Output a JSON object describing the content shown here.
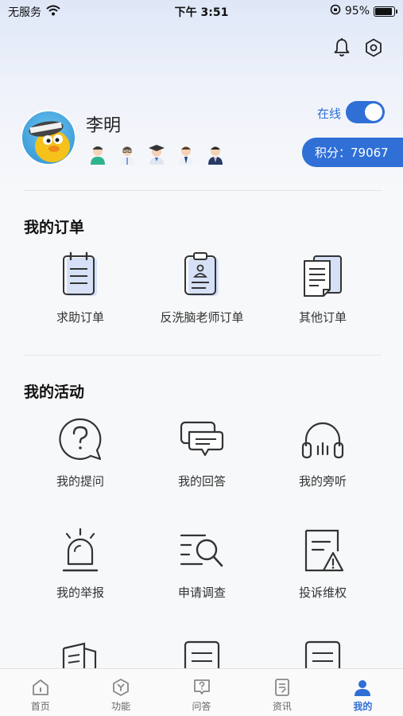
{
  "status_bar": {
    "carrier": "无服务",
    "time": "下午 3:51",
    "battery": "95%"
  },
  "header": {
    "icons": [
      "bell-icon",
      "settings-icon"
    ]
  },
  "profile": {
    "name": "李明",
    "online_label": "在线",
    "online": true,
    "points_text": "积分：79067",
    "badge_icons": [
      "nurse-badge-icon",
      "doctor-badge-icon",
      "graduate-badge-icon",
      "officer-badge-icon",
      "businessman-badge-icon"
    ]
  },
  "orders": {
    "title": "我的订单",
    "items": [
      {
        "label": "求助订单",
        "icon": "clipboard-icon"
      },
      {
        "label": "反洗脑老师订单",
        "icon": "teacher-clipboard-icon"
      },
      {
        "label": "其他订单",
        "icon": "documents-icon"
      }
    ]
  },
  "activities": {
    "title": "我的活动",
    "items": [
      {
        "label": "我的提问",
        "icon": "question-bubble-icon"
      },
      {
        "label": "我的回答",
        "icon": "answer-bubbles-icon"
      },
      {
        "label": "我的旁听",
        "icon": "headphones-icon"
      },
      {
        "label": "我的举报",
        "icon": "alarm-light-icon"
      },
      {
        "label": "申请调查",
        "icon": "search-list-icon"
      },
      {
        "label": "投诉维权",
        "icon": "complaint-document-icon"
      }
    ]
  },
  "tabs": [
    {
      "label": "首页",
      "icon": "home-icon",
      "active": false
    },
    {
      "label": "功能",
      "icon": "function-hexagon-icon",
      "active": false
    },
    {
      "label": "问答",
      "icon": "qa-icon",
      "active": false
    },
    {
      "label": "资讯",
      "icon": "news-icon",
      "active": false
    },
    {
      "label": "我的",
      "icon": "user-icon",
      "active": true
    }
  ],
  "colors": {
    "accent": "#2f6fd6",
    "icon_fill_light": "#d6e1f7",
    "icon_stroke": "#333333"
  }
}
